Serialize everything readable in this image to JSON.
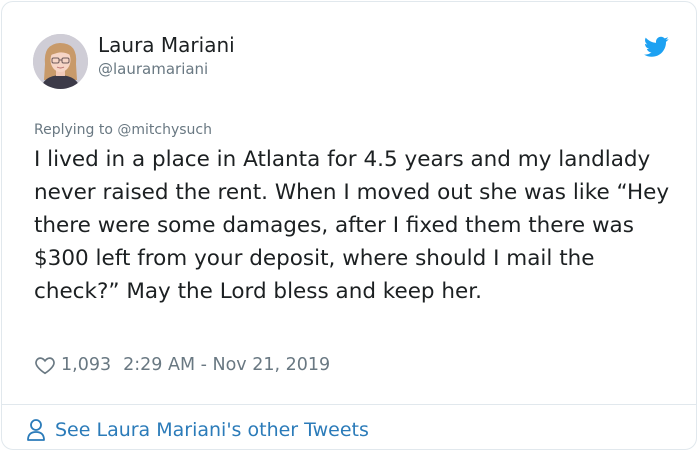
{
  "author": {
    "name": "Laura Mariani",
    "handle": "@lauramariani"
  },
  "reply": {
    "prefix": "Replying to ",
    "to_handle": "@mitchysuch"
  },
  "tweet": {
    "text": "I lived in a place in Atlanta for 4.5 years and my landlady never raised the rent. When I moved out she was like “Hey there were some damages, after I fixed them there was $300 left from your deposit, where should I mail the check?” May the Lord bless and keep her."
  },
  "meta": {
    "likes": "1,093",
    "timestamp": "2:29 AM - Nov 21, 2019"
  },
  "footer": {
    "link_label": "See Laura Mariani's other Tweets"
  },
  "icons": {
    "brand": "twitter-bird-icon",
    "like": "heart-icon",
    "profile": "person-icon"
  },
  "colors": {
    "brand_blue": "#1da1f2",
    "link_blue": "#2b7bb9",
    "secondary_text": "#697882",
    "primary_text": "#1c2022",
    "border": "#e1e8ed"
  }
}
